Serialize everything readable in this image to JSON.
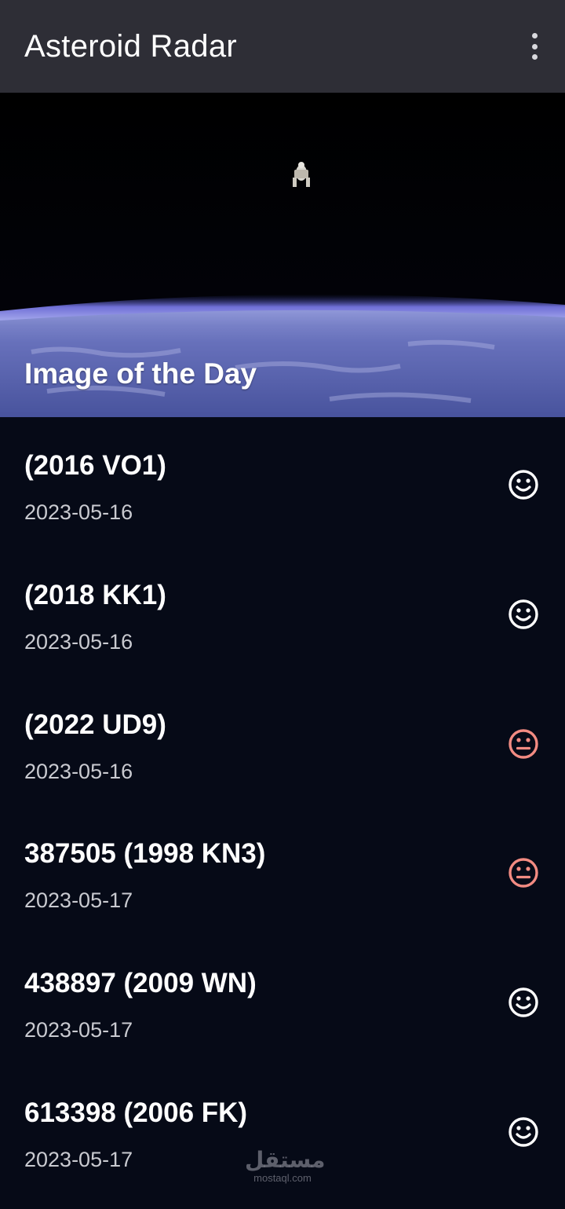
{
  "app": {
    "title": "Asteroid Radar",
    "menu_icon": "more-vert-icon"
  },
  "hero": {
    "caption": "Image of the Day",
    "image": "astronaut floating above Earth"
  },
  "asteroids": [
    {
      "name": "(2016 VO1)",
      "date": "2023-05-16",
      "status_icon": "happy-face-icon",
      "hazardous": false
    },
    {
      "name": "(2018 KK1)",
      "date": "2023-05-16",
      "status_icon": "happy-face-icon",
      "hazardous": false
    },
    {
      "name": "(2022 UD9)",
      "date": "2023-05-16",
      "status_icon": "neutral-face-icon",
      "hazardous": true
    },
    {
      "name": "387505 (1998 KN3)",
      "date": "2023-05-17",
      "status_icon": "neutral-face-icon",
      "hazardous": true
    },
    {
      "name": "438897 (2009 WN)",
      "date": "2023-05-17",
      "status_icon": "happy-face-icon",
      "hazardous": false
    },
    {
      "name": "613398 (2006 FK)",
      "date": "2023-05-17",
      "status_icon": "happy-face-icon",
      "hazardous": false
    }
  ],
  "colors": {
    "app_bar": "#2e2e36",
    "background": "#060a17",
    "safe_icon": "#ffffff",
    "hazard_icon": "#f28b82"
  },
  "watermark": {
    "arabic": "مستقل",
    "latin": "mostaql.com"
  }
}
